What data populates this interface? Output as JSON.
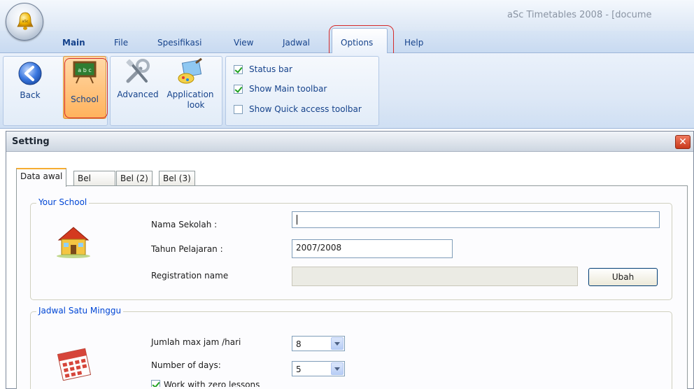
{
  "app": {
    "title": "aSc Timetables 2008  - [docume"
  },
  "ribbon": {
    "tabs": [
      {
        "label": "Main"
      },
      {
        "label": "File"
      },
      {
        "label": "Spesifikasi"
      },
      {
        "label": "View"
      },
      {
        "label": "Jadwal"
      },
      {
        "label": "Options"
      },
      {
        "label": "Help"
      }
    ],
    "active_tab": "Options",
    "buttons": {
      "back": "Back",
      "school": "School",
      "advanced": "Advanced",
      "application_look_1": "Application",
      "application_look_2": "look"
    },
    "checks": [
      {
        "label": "Status bar",
        "checked": true
      },
      {
        "label": "Show Main toolbar",
        "checked": true
      },
      {
        "label": "Show Quick access toolbar",
        "checked": false
      }
    ]
  },
  "dialog": {
    "title": "Setting",
    "tabs": [
      "Data awal",
      "Bel",
      "Bel (2)",
      "Bel (3)"
    ],
    "active_tab": "Data awal",
    "your_school": {
      "legend": "Your School",
      "nama_sekolah_label": "Nama Sekolah :",
      "nama_sekolah_value": "",
      "tahun_label": "Tahun Pelajaran :",
      "tahun_value": "2007/2008",
      "registration_label": "Registration name",
      "registration_value": "",
      "ubah_button": "Ubah"
    },
    "jadwal": {
      "legend": "Jadwal Satu Minggu",
      "max_jam_label": "Jumlah max jam /hari",
      "max_jam_value": "8",
      "days_label": "Number of days:",
      "days_value": "5",
      "zero_lessons_label": "Work with zero lessons"
    }
  },
  "colors": {
    "accent": "#15428b",
    "highlight": "#d42b2b",
    "tab_active_border": "#f6ad32"
  }
}
